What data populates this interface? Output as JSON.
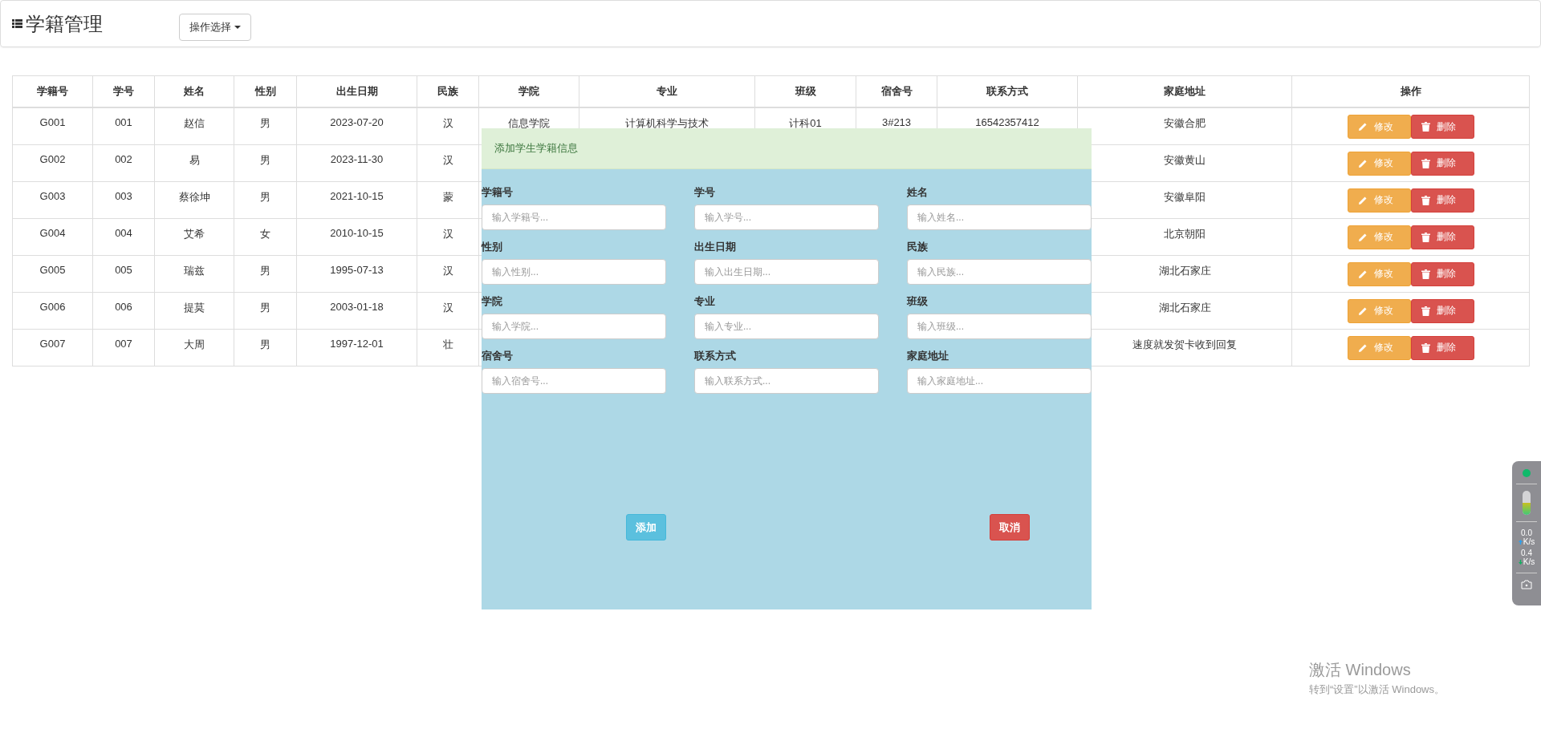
{
  "header": {
    "title": "学籍管理",
    "dropdown": {
      "label": "操作选择"
    }
  },
  "table": {
    "columns": [
      "学籍号",
      "学号",
      "姓名",
      "性别",
      "出生日期",
      "民族",
      "学院",
      "专业",
      "班级",
      "宿舍号",
      "联系方式",
      "家庭地址",
      "操作"
    ],
    "rows": [
      {
        "student_record_no": "G001",
        "student_no": "001",
        "name": "赵信",
        "gender": "男",
        "birth_date": "2023-07-20",
        "ethnicity": "汉",
        "college": "信息学院",
        "major": "计算机科学与技术",
        "class": "计科01",
        "dorm": "3#213",
        "contact": "16542357412",
        "address": "安徽合肥",
        "actions": [
          {
            "label": "修改",
            "kind": "edit"
          },
          {
            "label": "删除",
            "kind": "delete"
          }
        ]
      },
      {
        "student_record_no": "G002",
        "student_no": "002",
        "name": "易",
        "gender": "男",
        "birth_date": "2023-11-30",
        "ethnicity": "汉",
        "address": "安徽黄山",
        "actions": [
          {
            "label": "修改",
            "kind": "edit"
          },
          {
            "label": "删除",
            "kind": "delete"
          }
        ]
      },
      {
        "student_record_no": "G003",
        "student_no": "003",
        "name": "蔡徐坤",
        "gender": "男",
        "birth_date": "2021-10-15",
        "ethnicity": "蒙",
        "address": "安徽阜阳",
        "actions": [
          {
            "label": "修改",
            "kind": "edit"
          },
          {
            "label": "删除",
            "kind": "delete"
          }
        ]
      },
      {
        "student_record_no": "G004",
        "student_no": "004",
        "name": "艾希",
        "gender": "女",
        "birth_date": "2010-10-15",
        "ethnicity": "汉",
        "address": "北京朝阳",
        "actions": [
          {
            "label": "修改",
            "kind": "edit"
          },
          {
            "label": "删除",
            "kind": "delete"
          }
        ]
      },
      {
        "student_record_no": "G005",
        "student_no": "005",
        "name": "瑞兹",
        "gender": "男",
        "birth_date": "1995-07-13",
        "ethnicity": "汉",
        "address": "湖北石家庄",
        "actions": [
          {
            "label": "修改",
            "kind": "edit"
          },
          {
            "label": "删除",
            "kind": "delete"
          }
        ]
      },
      {
        "student_record_no": "G006",
        "student_no": "006",
        "name": "提莫",
        "gender": "男",
        "birth_date": "2003-01-18",
        "ethnicity": "汉",
        "address": "湖北石家庄",
        "actions": [
          {
            "label": "修改",
            "kind": "edit"
          },
          {
            "label": "删除",
            "kind": "delete"
          }
        ]
      },
      {
        "student_record_no": "G007",
        "student_no": "007",
        "name": "大周",
        "gender": "男",
        "birth_date": "1997-12-01",
        "ethnicity": "壮",
        "address": "速度就发贺卡收到回复",
        "actions": [
          {
            "label": "修改",
            "kind": "edit"
          },
          {
            "label": "删除",
            "kind": "delete"
          }
        ]
      }
    ]
  },
  "modal": {
    "title": "添加学生学籍信息",
    "fields": [
      {
        "label": "学籍号",
        "placeholder": "输入学籍号..."
      },
      {
        "label": "学号",
        "placeholder": "输入学号..."
      },
      {
        "label": "姓名",
        "placeholder": "输入姓名..."
      },
      {
        "label": "性别",
        "placeholder": "输入性别..."
      },
      {
        "label": "出生日期",
        "placeholder": "输入出生日期..."
      },
      {
        "label": "民族",
        "placeholder": "输入民族..."
      },
      {
        "label": "学院",
        "placeholder": "输入学院..."
      },
      {
        "label": "专业",
        "placeholder": "输入专业..."
      },
      {
        "label": "班级",
        "placeholder": "输入班级..."
      },
      {
        "label": "宿舍号",
        "placeholder": "输入宿舍号..."
      },
      {
        "label": "联系方式",
        "placeholder": "输入联系方式..."
      },
      {
        "label": "家庭地址",
        "placeholder": "输入家庭地址..."
      }
    ],
    "buttons": [
      {
        "label": "添加",
        "kind": "primary"
      },
      {
        "label": "取消",
        "kind": "cancel"
      }
    ]
  },
  "net_widget": {
    "upload": {
      "value": "0.0",
      "unit": "K/s"
    },
    "download": {
      "value": "0.4",
      "unit": "K/s"
    }
  },
  "activation_notice": {
    "title": "激活 Windows",
    "text": "转到“设置”以激活 Windows。"
  }
}
